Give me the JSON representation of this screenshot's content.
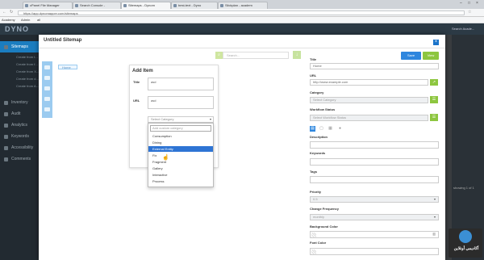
{
  "browser": {
    "tabs": [
      {
        "label": "cPanel File Manager"
      },
      {
        "label": "Search Console -"
      },
      {
        "label": "Sitemaps - Dynom"
      },
      {
        "label": "best-text - Dyno"
      },
      {
        "label": "Slickplan - academ"
      }
    ],
    "url": "https://app.dynomapper.com/sitemaps",
    "bookmarks": [
      "Academy",
      "Admin",
      "all"
    ]
  },
  "app": {
    "logo": "DYNO",
    "account": "Search Acade...",
    "nav": [
      {
        "label": "Sitemaps",
        "active": true
      },
      {
        "label": "Inventory"
      },
      {
        "label": "Audit"
      },
      {
        "label": "Analytics"
      },
      {
        "label": "Keywords"
      },
      {
        "label": "Accessibility"
      },
      {
        "label": "Comments"
      }
    ],
    "subnav": [
      "Create from t...",
      "Create from f...",
      "Create from X...",
      "Create from d...",
      "Create from A..."
    ],
    "side_info": "showing 1 of 1"
  },
  "modal": {
    "title": "Untitled Sitemap",
    "close": "×",
    "search_placeholder": "Search...",
    "home_node": "Home",
    "save_label": "Save",
    "view_label": "View"
  },
  "add_item": {
    "title": "Add Item",
    "title_label": "Title",
    "title_value": "asd",
    "url_label": "URL",
    "url_value": "asd",
    "category_placeholder": "Select Category",
    "category_search_placeholder": "Add custom category",
    "options": [
      "Consumption",
      "Dining",
      "External Entity",
      "Fix",
      "Fragment",
      "Gallery",
      "Interactive",
      "Process"
    ],
    "highlighted": "External Entity"
  },
  "form": {
    "title_label": "Title",
    "title_value": "Home",
    "url_label": "URL",
    "url_value": "http://www.example.com",
    "category_label": "Category",
    "category_placeholder": "Select Category",
    "workflow_label": "Workflow Status",
    "workflow_placeholder": "Select Workflow Status",
    "description_label": "Description",
    "keywords_label": "Keywords",
    "tags_label": "Tags",
    "priority_label": "Priority",
    "priority_value": "0.5",
    "change_freq_label": "Change Frequency",
    "change_freq_value": "monthly",
    "bg_color_label": "Background Color",
    "font_color_label": "Font Color"
  },
  "watermark": {
    "text": "أكاديمي أونلاين"
  },
  "colors": {
    "primary": "#2e86de",
    "success": "#8dc63f",
    "sidebar": "#222a31",
    "highlight": "#2e74d4"
  }
}
